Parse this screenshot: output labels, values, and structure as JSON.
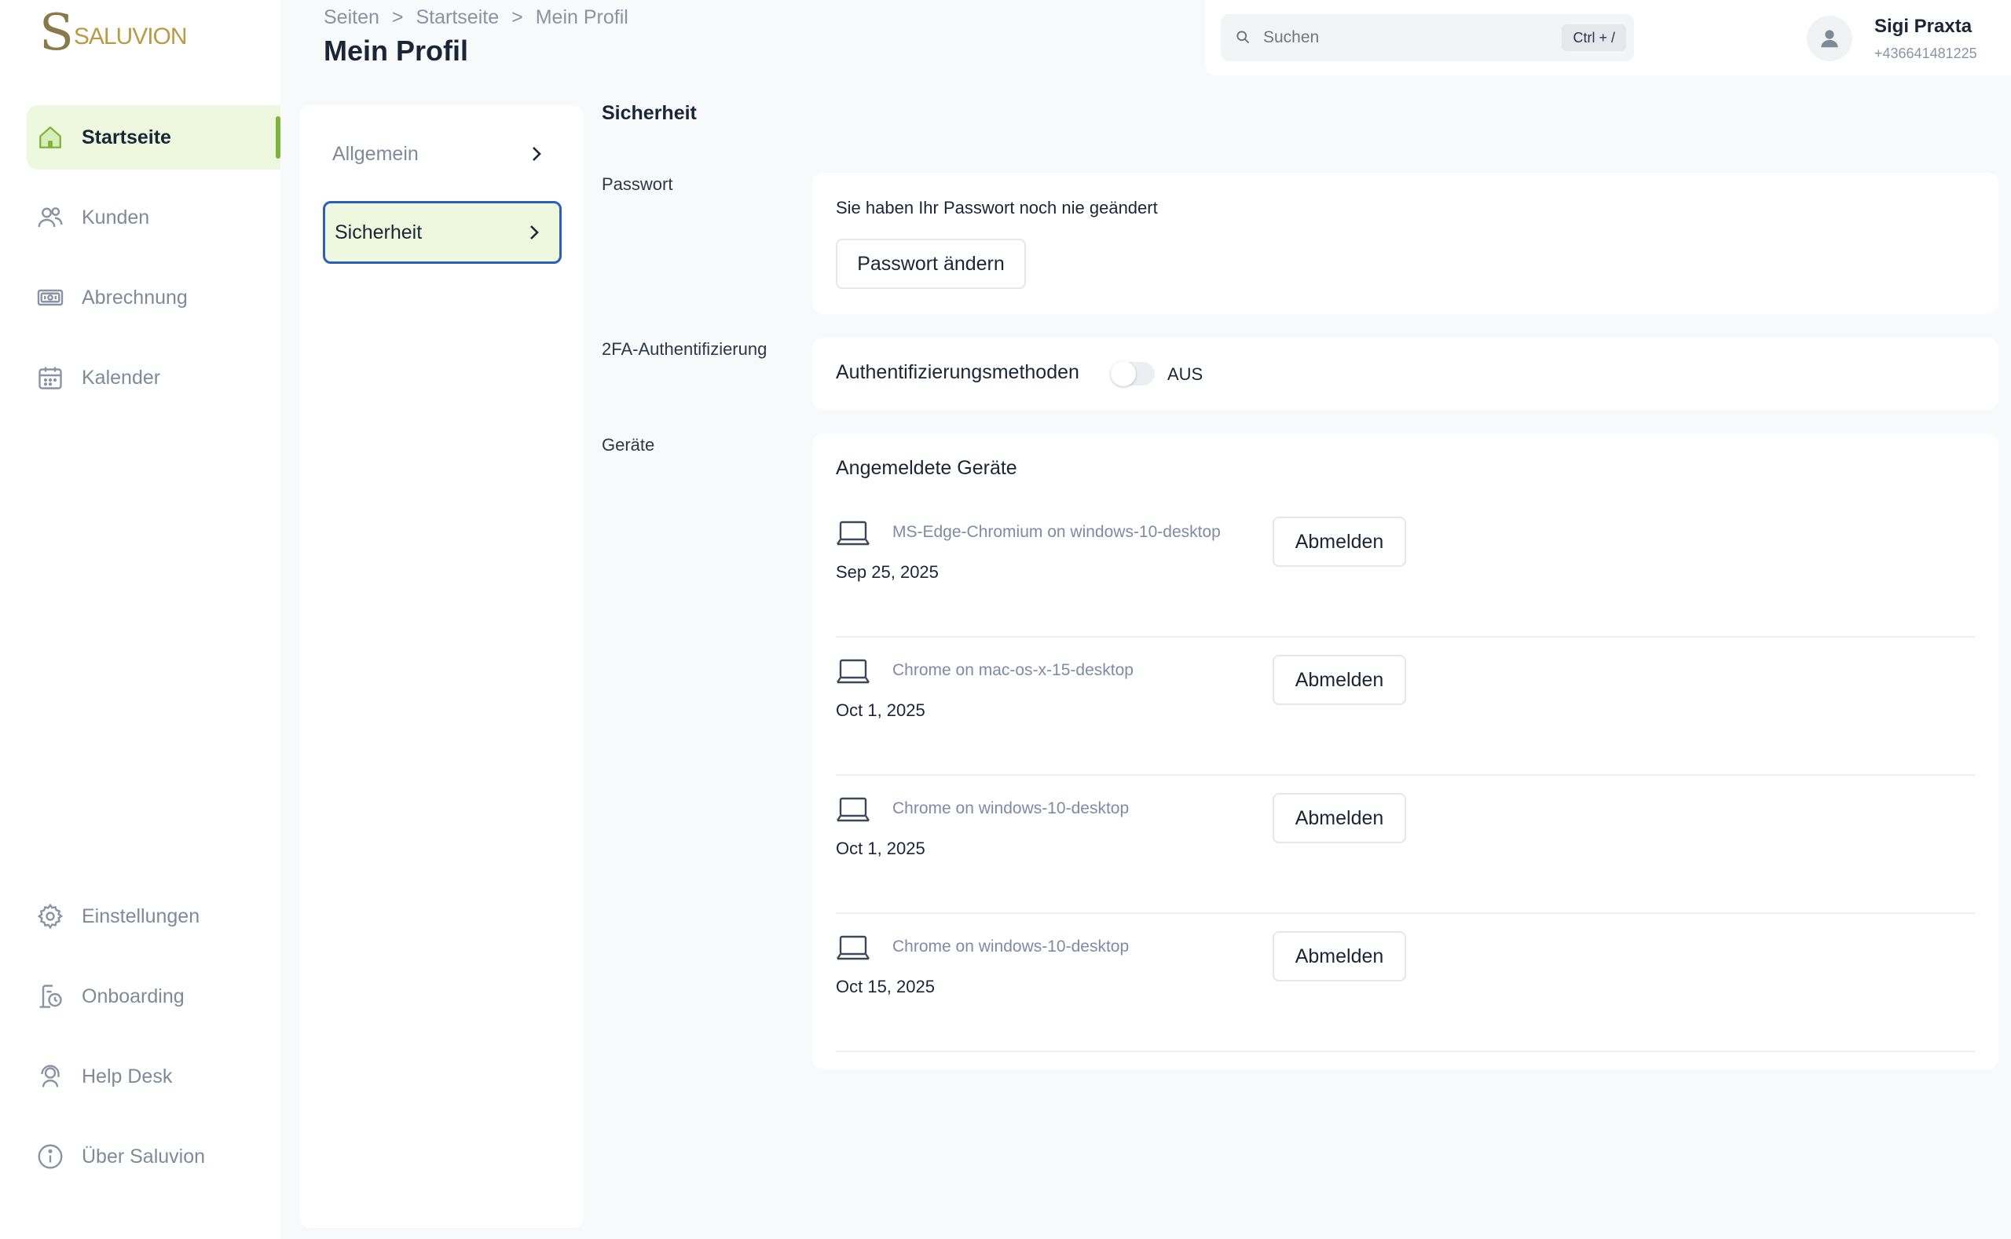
{
  "brand": {
    "logo_letter": "S",
    "logo_text": "SALUVION"
  },
  "sidebar": {
    "items": [
      {
        "label": "Startseite",
        "icon": "home-icon",
        "active": true
      },
      {
        "label": "Kunden",
        "icon": "users-icon"
      },
      {
        "label": "Abrechnung",
        "icon": "billing-icon"
      },
      {
        "label": "Kalender",
        "icon": "calendar-icon"
      }
    ],
    "bottom_items": [
      {
        "label": "Einstellungen",
        "icon": "gear-icon"
      },
      {
        "label": "Onboarding",
        "icon": "onboarding-icon"
      },
      {
        "label": "Help Desk",
        "icon": "headset-icon"
      },
      {
        "label": "Über Saluvion",
        "icon": "info-icon"
      }
    ]
  },
  "header": {
    "breadcrumb": [
      "Seiten",
      ">",
      "Startseite",
      ">",
      "Mein Profil"
    ],
    "title": "Mein Profil"
  },
  "topbar": {
    "search_placeholder": "Suchen",
    "search_shortcut": "Ctrl + /",
    "user_name": "Sigi Praxta",
    "user_phone": "+436641481225"
  },
  "profile_menu": {
    "items": [
      {
        "label": "Allgemein",
        "active": false
      },
      {
        "label": "Sicherheit",
        "active": true
      }
    ]
  },
  "security": {
    "section_title": "Sicherheit",
    "password": {
      "label": "Passwort",
      "status_text": "Sie haben Ihr Passwort noch nie geändert",
      "button": "Passwort ändern"
    },
    "twofa": {
      "label": "2FA-Authentifizierung",
      "methods_label": "Authentifizierungsmethoden",
      "toggle_state": "AUS"
    },
    "devices": {
      "label": "Geräte",
      "title": "Angemeldete Geräte",
      "logout_label": "Abmelden",
      "list": [
        {
          "name": "MS-Edge-Chromium on windows-10-desktop",
          "date": "Sep 25, 2025"
        },
        {
          "name": "Chrome on mac-os-x-15-desktop",
          "date": "Oct 1, 2025"
        },
        {
          "name": "Chrome on windows-10-desktop",
          "date": "Oct 1, 2025"
        },
        {
          "name": "Chrome on windows-10-desktop",
          "date": "Oct 15, 2025"
        }
      ]
    }
  },
  "colors": {
    "accent_green": "#7fb339",
    "active_bg": "#eef8df",
    "focus_blue": "#2b5fb8",
    "logo_gold": "#b89b45"
  }
}
